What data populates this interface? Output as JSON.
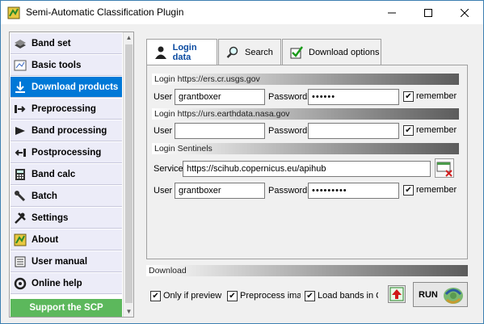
{
  "window": {
    "title": "Semi-Automatic Classification Plugin"
  },
  "sidebar": {
    "items": [
      {
        "label": "Band set",
        "icon": "band-set-icon"
      },
      {
        "label": "Basic tools",
        "icon": "basic-tools-icon"
      },
      {
        "label": "Download products",
        "icon": "download-icon",
        "active": true
      },
      {
        "label": "Preprocessing",
        "icon": "preprocessing-icon"
      },
      {
        "label": "Band processing",
        "icon": "band-processing-icon"
      },
      {
        "label": "Postprocessing",
        "icon": "postprocessing-icon"
      },
      {
        "label": "Band calc",
        "icon": "band-calc-icon"
      },
      {
        "label": "Batch",
        "icon": "batch-icon"
      },
      {
        "label": "Settings",
        "icon": "settings-icon"
      },
      {
        "label": "About",
        "icon": "about-icon"
      },
      {
        "label": "User manual",
        "icon": "user-manual-icon"
      },
      {
        "label": "Online help",
        "icon": "online-help-icon"
      }
    ],
    "support_label": "Support the SCP"
  },
  "tabs": [
    {
      "label": "Login data",
      "icon": "user-icon",
      "active": true
    },
    {
      "label": "Search",
      "icon": "search-icon"
    },
    {
      "label": "Download options",
      "icon": "checkmark-icon"
    }
  ],
  "login": {
    "usgs": {
      "header": "Login https://ers.cr.usgs.gov",
      "user_label": "User",
      "user_value": "grantboxer",
      "password_label": "Password",
      "password_value": "••••••",
      "remember_label": "remember"
    },
    "earthdata": {
      "header": "Login https://urs.earthdata.nasa.gov",
      "user_label": "User",
      "user_value": "",
      "password_label": "Password",
      "password_value": "",
      "remember_label": "remember"
    },
    "sentinels": {
      "header": "Login Sentinels",
      "service_label": "Service",
      "service_value": "https://scihub.copernicus.eu/apihub",
      "user_label": "User",
      "user_value": "grantboxer",
      "password_label": "Password",
      "password_value": "•••••••••",
      "remember_label": "remember"
    }
  },
  "download": {
    "header": "Download",
    "only_preview_label": "Only if preview in",
    "preprocess_label": "Preprocess image",
    "load_bands_label": "Load bands in QG",
    "run_label": "RUN"
  }
}
